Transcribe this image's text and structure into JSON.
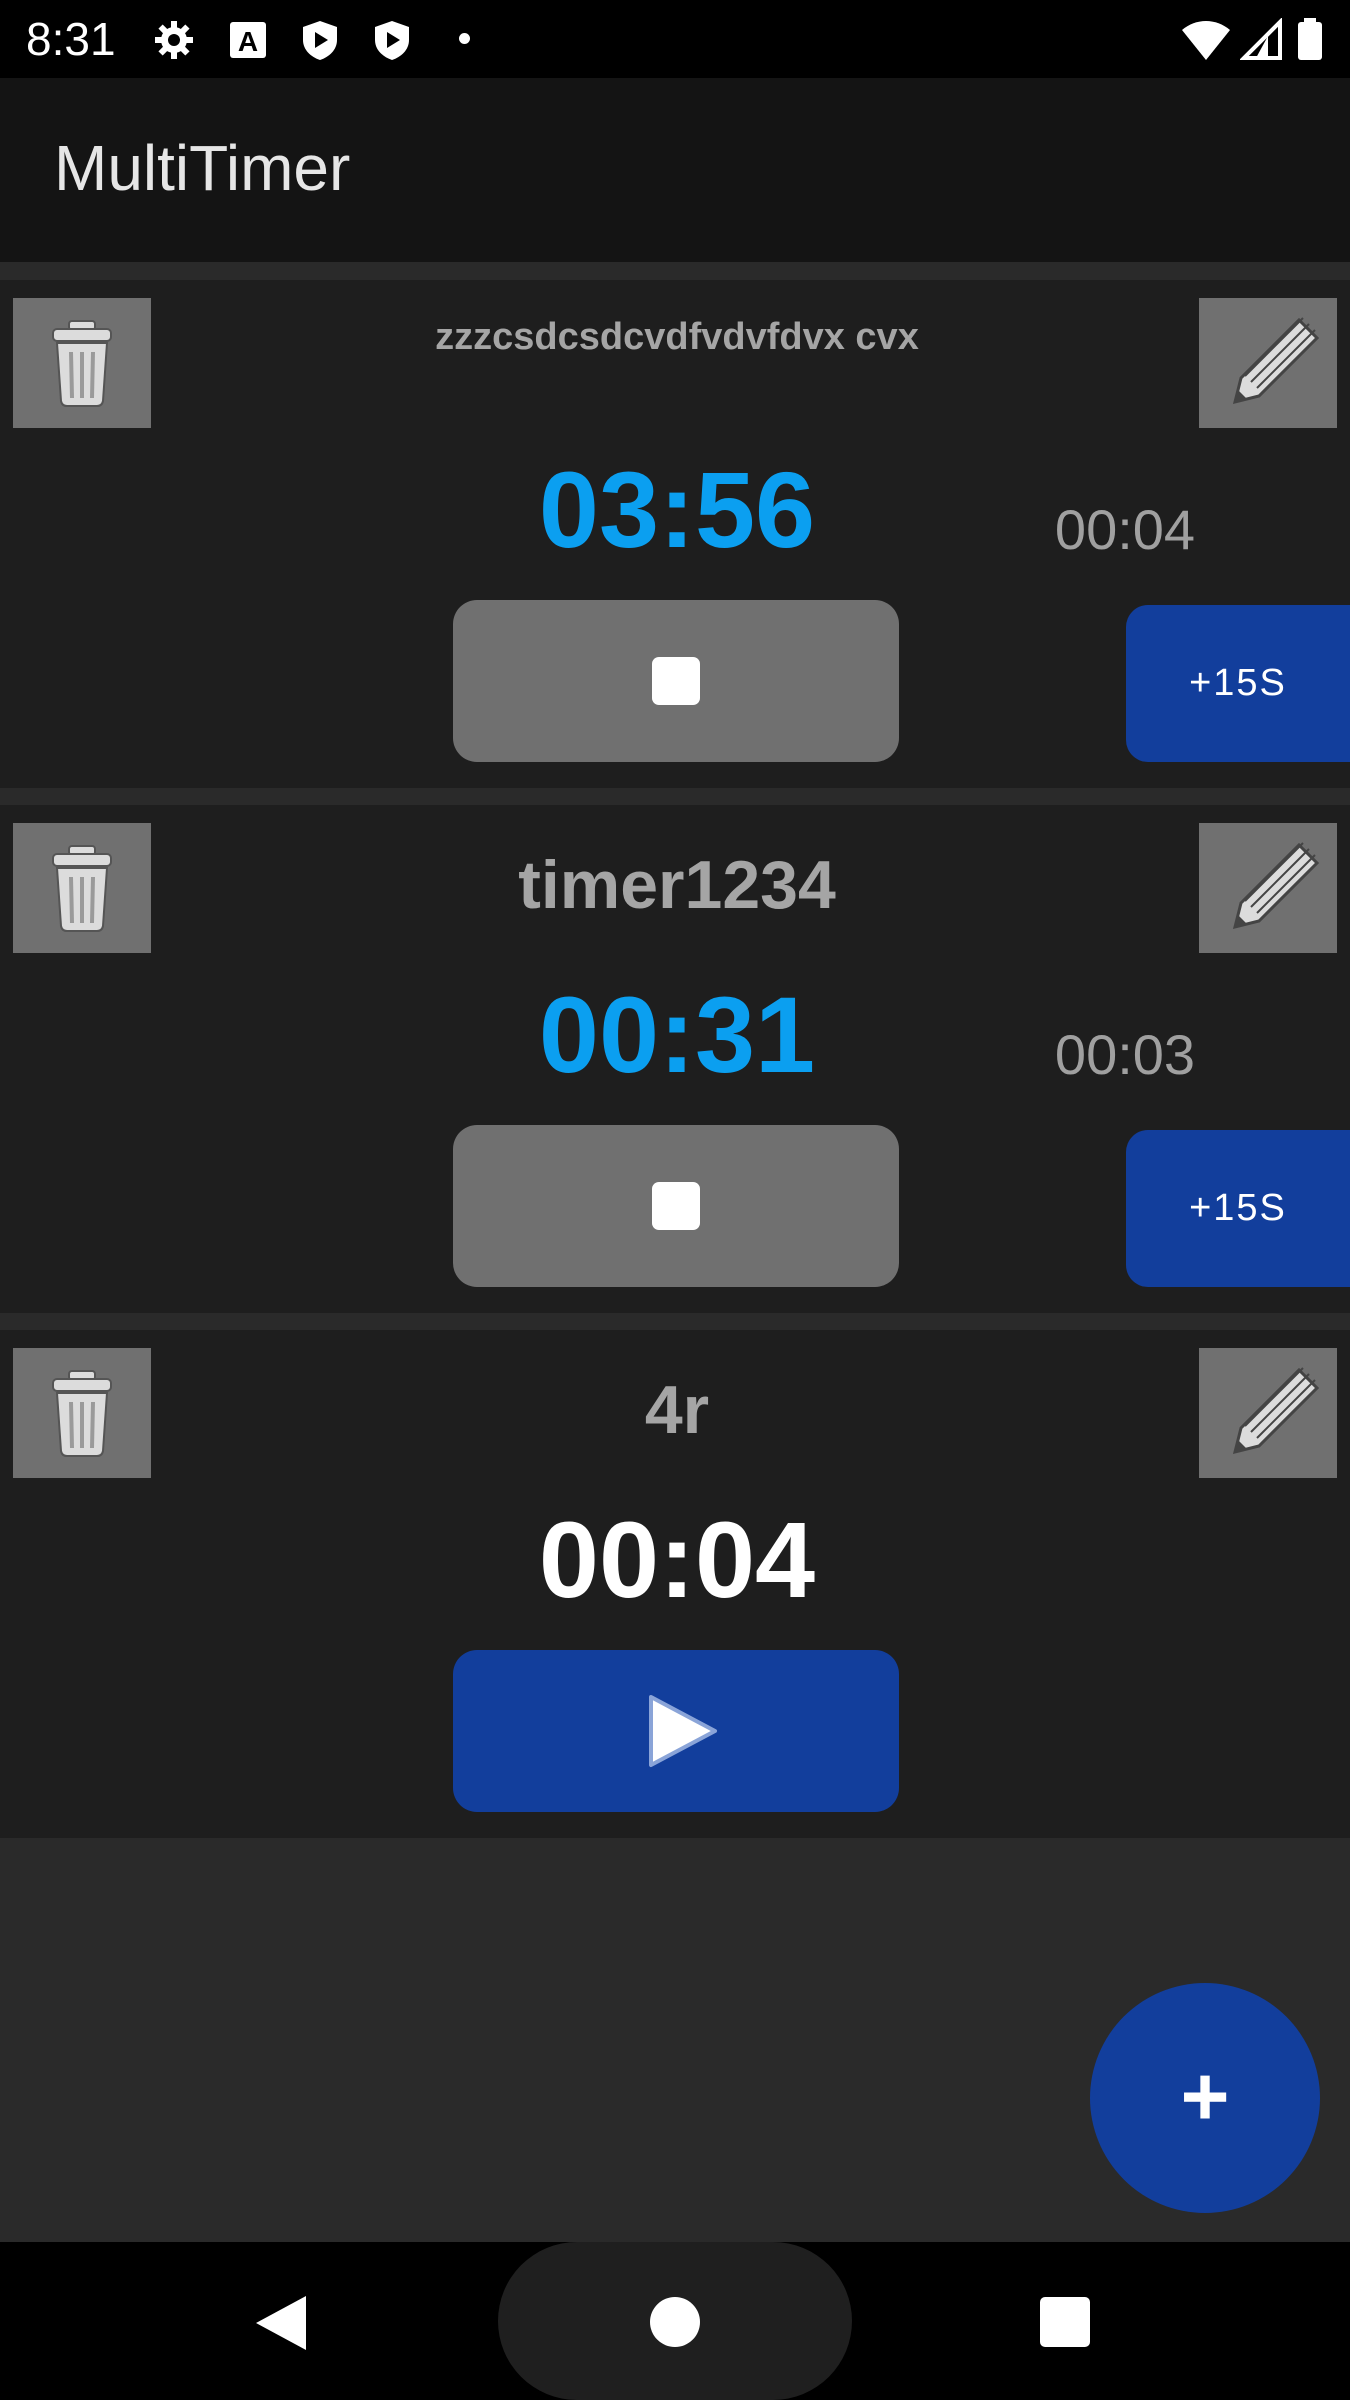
{
  "status_bar": {
    "time": "8:31",
    "left_icons": [
      "gear-icon",
      "font-a-icon",
      "shield-play-icon",
      "shield-play-icon",
      "dot-icon"
    ],
    "right_icons": [
      "wifi-icon",
      "cell-signal-icon",
      "battery-icon"
    ]
  },
  "app_bar": {
    "title": "MultiTimer"
  },
  "timers": [
    {
      "name": "zzzcsdcsdcvdfvdvfdvx cvx",
      "time": "03:56",
      "elapsed": "00:04",
      "state": "running",
      "add_label": "+15S"
    },
    {
      "name": "timer1234",
      "time": "00:31",
      "elapsed": "00:03",
      "state": "running",
      "add_label": "+15S"
    },
    {
      "name": "4r",
      "time": "00:04",
      "elapsed": "",
      "state": "stopped",
      "add_label": ""
    }
  ],
  "fab": {
    "label": "+"
  },
  "colors": {
    "accent_blue": "#123e9c",
    "running_time": "#0b9ff0",
    "stopped_time": "#ffffff",
    "card_bg": "#1e1e1e",
    "button_gray": "#707070"
  },
  "nav_bar": {
    "icons": [
      "back-icon",
      "home-icon",
      "recents-icon"
    ]
  }
}
